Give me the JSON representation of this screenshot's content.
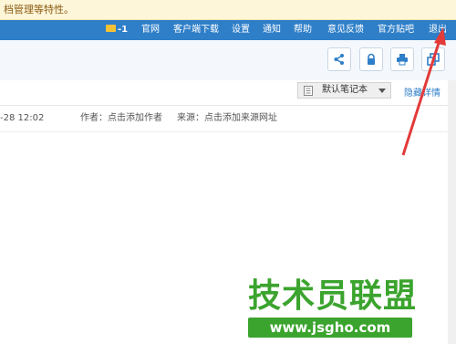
{
  "notice": {
    "text": "档管理等特性。"
  },
  "topnav": {
    "mail_count": "-1",
    "items": [
      "官网",
      "客户端下载",
      "设置",
      "通知",
      "帮助",
      "意见反馈",
      "官方贴吧",
      "退出"
    ]
  },
  "toolbar": {
    "buttons": [
      "share-icon",
      "lock-icon",
      "print-icon",
      "window-icon"
    ]
  },
  "notebook": {
    "selected": "默认笔记本",
    "hide_details": "隐藏详情"
  },
  "meta": {
    "date": "-28 12:02",
    "author": "作者：点击添加作者",
    "source": "来源：点击添加来源网址"
  },
  "watermark": {
    "title": "技术员联盟",
    "url": "www.jsgho.com"
  },
  "colors": {
    "nav_bg": "#2f7fc8",
    "notice_bg": "#fdf6d8",
    "arrow": "#e33a3a",
    "watermark": "#3ba42e"
  }
}
